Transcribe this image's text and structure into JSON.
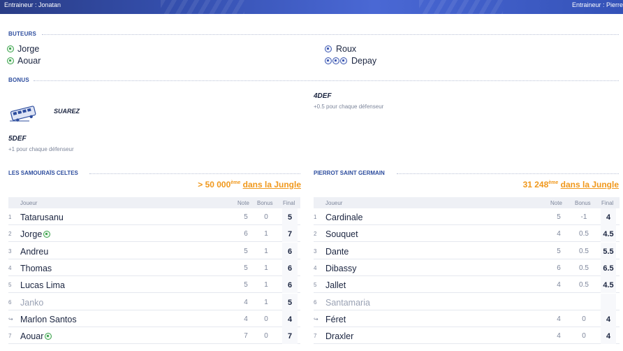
{
  "header": {
    "coach_left": "Entraineur : Jonatan",
    "coach_right": "Entraineur : Pierre"
  },
  "scorers": {
    "title": "BUTEURS",
    "home": [
      {
        "name": "Jorge",
        "goals": 1
      },
      {
        "name": "Aouar",
        "goals": 1
      }
    ],
    "away": [
      {
        "name": "Roux",
        "goals": 1
      },
      {
        "name": "Depay",
        "goals": 3
      }
    ]
  },
  "bonus": {
    "title": "BONUS",
    "home_player": "SUAREZ",
    "home_name": "5DEF",
    "home_desc": "+1 pour chaque défenseur",
    "away_name": "4DEF",
    "away_desc": "+0.5 pour chaque défenseur"
  },
  "teams": [
    {
      "name": "LES SAMOURAÏS CELTES",
      "rank_value": "> 50 000",
      "rank_sup": "ème",
      "rank_link": "dans la Jungle",
      "headers": {
        "player": "Joueur",
        "note": "Note",
        "bonus": "Bonus",
        "final": "Final"
      },
      "rows": [
        {
          "idx": "1",
          "name": "Tatarusanu",
          "note": "5",
          "bonus": "0",
          "final": "5"
        },
        {
          "idx": "2",
          "name": "Jorge",
          "note": "6",
          "bonus": "1",
          "final": "7",
          "goal": true
        },
        {
          "idx": "3",
          "name": "Andreu",
          "note": "5",
          "bonus": "1",
          "final": "6"
        },
        {
          "idx": "4",
          "name": "Thomas",
          "note": "5",
          "bonus": "1",
          "final": "6"
        },
        {
          "idx": "5",
          "name": "Lucas Lima",
          "note": "5",
          "bonus": "1",
          "final": "6"
        },
        {
          "idx": "6",
          "name": "Janko",
          "note": "4",
          "bonus": "1",
          "final": "5",
          "subbed_out": true
        },
        {
          "idx": "↪",
          "name": "Marlon Santos",
          "note": "4",
          "bonus": "0",
          "final": "4",
          "sub_in": true
        },
        {
          "idx": "7",
          "name": "Aouar",
          "note": "7",
          "bonus": "0",
          "final": "7",
          "goal": true
        }
      ]
    },
    {
      "name": "PIERROT SAINT GERMAIN",
      "rank_value": "31 248",
      "rank_sup": "ème",
      "rank_link": "dans la Jungle",
      "headers": {
        "player": "Joueur",
        "note": "Note",
        "bonus": "Bonus",
        "final": "Final"
      },
      "rows": [
        {
          "idx": "1",
          "name": "Cardinale",
          "note": "5",
          "bonus": "-1",
          "final": "4"
        },
        {
          "idx": "2",
          "name": "Souquet",
          "note": "4",
          "bonus": "0.5",
          "final": "4.5"
        },
        {
          "idx": "3",
          "name": "Dante",
          "note": "5",
          "bonus": "0.5",
          "final": "5.5"
        },
        {
          "idx": "4",
          "name": "Dibassy",
          "note": "6",
          "bonus": "0.5",
          "final": "6.5"
        },
        {
          "idx": "5",
          "name": "Jallet",
          "note": "4",
          "bonus": "0.5",
          "final": "4.5"
        },
        {
          "idx": "6",
          "name": "Santamaria",
          "note": "",
          "bonus": "",
          "final": "",
          "subbed_out": true
        },
        {
          "idx": "↪",
          "name": "Féret",
          "note": "4",
          "bonus": "0",
          "final": "4",
          "sub_in": true
        },
        {
          "idx": "7",
          "name": "Draxler",
          "note": "4",
          "bonus": "0",
          "final": "4"
        }
      ]
    }
  ]
}
